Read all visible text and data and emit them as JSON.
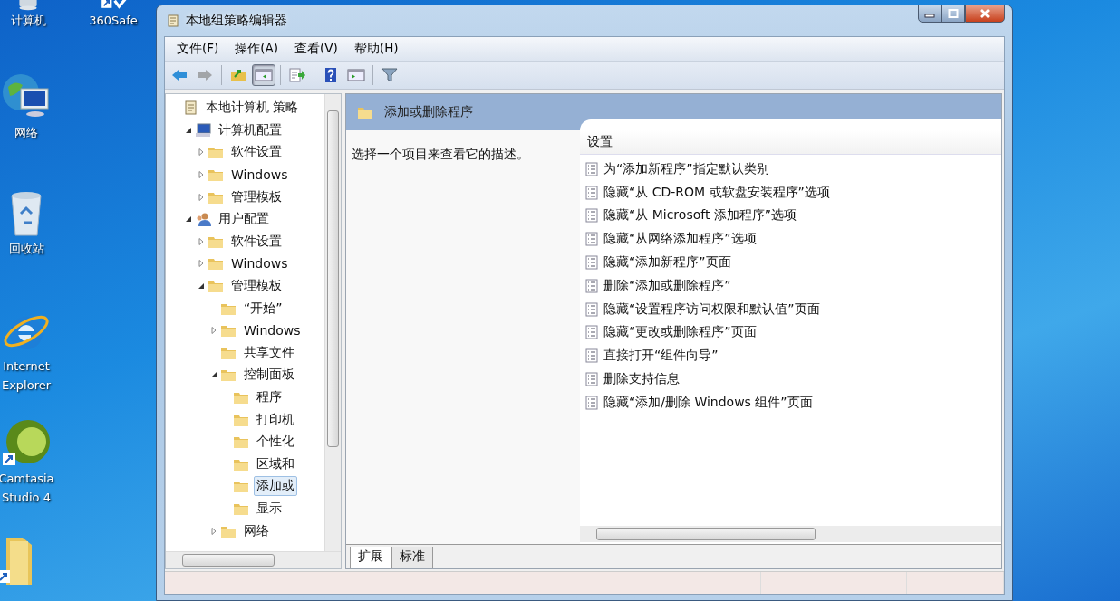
{
  "desktop_icons": [
    {
      "kind": "computer",
      "label": "计算机"
    },
    {
      "kind": "shield",
      "label": "360Safe"
    },
    {
      "kind": "network",
      "label": "网络"
    },
    {
      "kind": "recycle",
      "label": "回收站"
    },
    {
      "kind": "ie",
      "label": "Internet Explorer"
    },
    {
      "kind": "camtasia",
      "label": "Camtasia Studio 4"
    },
    {
      "kind": "folder"
    }
  ],
  "window": {
    "title": "本地组策略编辑器"
  },
  "menu": [
    "文件(F)",
    "操作(A)",
    "查看(V)",
    "帮助(H)"
  ],
  "toolbar": [
    {
      "kind": "back",
      "pressed": false,
      "disabled": false
    },
    {
      "kind": "forward",
      "pressed": false,
      "disabled": true
    },
    {
      "kind": "up",
      "pressed": false,
      "disabled": false
    },
    {
      "kind": "tree",
      "pressed": true,
      "disabled": false
    },
    {
      "kind": "export",
      "pressed": false,
      "disabled": false
    },
    {
      "kind": "help",
      "pressed": false,
      "disabled": false
    },
    {
      "kind": "pane",
      "pressed": false,
      "disabled": false
    },
    {
      "kind": "filter",
      "pressed": false,
      "disabled": false
    }
  ],
  "tree": [
    {
      "label": "本地计算机 策略",
      "kind": "policy",
      "selected": false,
      "children": [
        {
          "label": "计算机配置",
          "kind": "computer",
          "expanded": true,
          "selected": false,
          "children": [
            {
              "label": "软件设置",
              "kind": "folder",
              "expanded": false,
              "selected": false
            },
            {
              "label": "Windows",
              "kind": "folder",
              "expanded": false,
              "selected": false
            },
            {
              "label": "管理模板",
              "kind": "folder",
              "expanded": false,
              "selected": false
            }
          ]
        },
        {
          "label": "用户配置",
          "kind": "user",
          "expanded": true,
          "selected": false,
          "children": [
            {
              "label": "软件设置",
              "kind": "folder",
              "expanded": false,
              "selected": false
            },
            {
              "label": "Windows",
              "kind": "folder",
              "expanded": false,
              "selected": false
            },
            {
              "label": "管理模板",
              "kind": "folder",
              "expanded": true,
              "selected": false,
              "children": [
                {
                  "label": "“开始”",
                  "kind": "folder",
                  "selected": false
                },
                {
                  "label": "Windows",
                  "kind": "folder",
                  "expanded": false,
                  "selected": false
                },
                {
                  "label": "共享文件",
                  "kind": "folder",
                  "selected": false
                },
                {
                  "label": "控制面板",
                  "kind": "folder",
                  "expanded": true,
                  "selected": false,
                  "children": [
                    {
                      "label": "程序",
                      "kind": "folder",
                      "selected": false
                    },
                    {
                      "label": "打印机",
                      "kind": "folder",
                      "selected": false
                    },
                    {
                      "label": "个性化",
                      "kind": "folder",
                      "selected": false
                    },
                    {
                      "label": "区域和",
                      "kind": "folder",
                      "selected": false
                    },
                    {
                      "label": "添加或",
                      "kind": "folder",
                      "selected": true
                    },
                    {
                      "label": "显示",
                      "kind": "folder",
                      "selected": false
                    }
                  ]
                },
                {
                  "label": "网络",
                  "kind": "folder",
                  "expanded": false,
                  "selected": false
                }
              ]
            }
          ]
        }
      ]
    }
  ],
  "content": {
    "title": "添加或删除程序",
    "description": "选择一个项目来查看它的描述。",
    "column": "设置",
    "settings": [
      "为“添加新程序”指定默认类别",
      "隐藏“从 CD-ROM 或软盘安装程序”选项",
      "隐藏“从 Microsoft 添加程序”选项",
      "隐藏“从网络添加程序”选项",
      "隐藏“添加新程序”页面",
      "删除“添加或删除程序”",
      "隐藏“设置程序访问权限和默认值”页面",
      "隐藏“更改或删除程序”页面",
      "直接打开“组件向导”",
      "删除支持信息",
      "隐藏“添加/删除 Windows 组件”页面"
    ]
  },
  "view_tabs": [
    {
      "label": "扩展",
      "selected": true
    },
    {
      "label": "标准",
      "selected": false
    }
  ]
}
